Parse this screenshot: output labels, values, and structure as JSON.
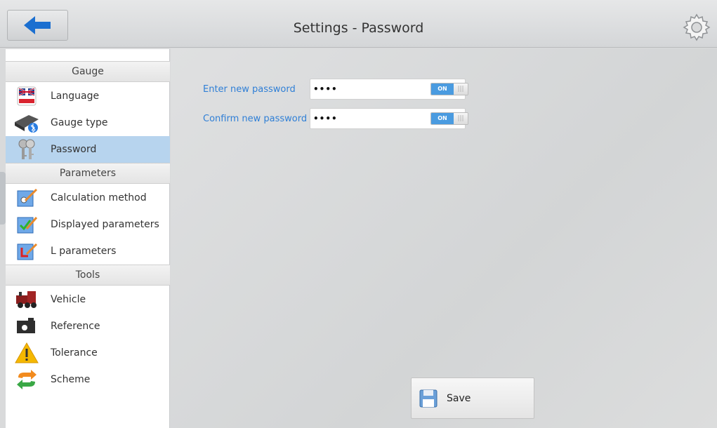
{
  "header": {
    "title": "Settings - Password",
    "back_icon": "arrow-left-icon",
    "settings_icon": "gear-icon"
  },
  "sidebar": {
    "sections": [
      {
        "title": "Gauge",
        "items": [
          {
            "label": "Language",
            "icon": "uk-flag-icon"
          },
          {
            "label": "Gauge type",
            "icon": "gauge-bluetooth-icon"
          },
          {
            "label": "Password",
            "icon": "keys-icon",
            "active": true
          }
        ]
      },
      {
        "title": "Parameters",
        "items": [
          {
            "label": "Calculation method",
            "icon": "calc-method-icon"
          },
          {
            "label": "Displayed parameters",
            "icon": "checklist-icon"
          },
          {
            "label": "L parameters",
            "icon": "l-param-icon"
          }
        ]
      },
      {
        "title": "Tools",
        "items": [
          {
            "label": "Vehicle",
            "icon": "locomotive-icon"
          },
          {
            "label": "Reference",
            "icon": "reference-icon"
          },
          {
            "label": "Tolerance",
            "icon": "warning-icon"
          },
          {
            "label": "Scheme",
            "icon": "sync-arrows-icon"
          }
        ]
      }
    ]
  },
  "form": {
    "new_password": {
      "label": "Enter new password",
      "value": "••••",
      "toggle": "ON"
    },
    "confirm_password": {
      "label": "Confirm new password",
      "value": "••••",
      "toggle": "ON"
    }
  },
  "save_button": {
    "label": "Save",
    "icon": "floppy-disk-icon"
  },
  "colors": {
    "accent": "#2f7fd6",
    "active_item": "#b7d4ee",
    "toggle_on": "#4a9be0",
    "back_arrow": "#1b6fd0"
  }
}
